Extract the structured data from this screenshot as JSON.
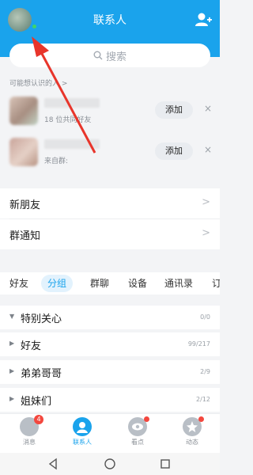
{
  "header": {
    "title": "联系人"
  },
  "search": {
    "placeholder": "搜索"
  },
  "suggestions": {
    "title": "可能想认识的人 >",
    "items": [
      {
        "subtitle": "18 位共同好友",
        "add_label": "添加",
        "dismiss": "×"
      },
      {
        "subtitle": "来自群:",
        "add_label": "添加",
        "dismiss": "×"
      }
    ]
  },
  "rows": [
    {
      "label": "新朋友",
      "chevron": ">"
    },
    {
      "label": "群通知",
      "chevron": ">"
    }
  ],
  "tabs": [
    "好友",
    "分组",
    "群聊",
    "设备",
    "通讯录",
    "订"
  ],
  "active_tab": "分组",
  "groups": [
    {
      "arrow": "▼",
      "name": "特别关心",
      "count": "0/0"
    },
    {
      "arrow": "▶",
      "name": "好友",
      "count": "99/217"
    },
    {
      "arrow": "▶",
      "name": "弟弟哥哥",
      "count": "2/9"
    },
    {
      "arrow": "▶",
      "name": "姐妹们",
      "count": "2/12"
    }
  ],
  "bottom_nav": [
    {
      "label": "消息",
      "badge": "4",
      "icon": "message-icon"
    },
    {
      "label": "联系人",
      "icon": "contacts-icon",
      "active": true
    },
    {
      "label": "看点",
      "icon": "eye-icon",
      "dot": true
    },
    {
      "label": "动态",
      "icon": "star-icon",
      "dot": true
    }
  ],
  "colors": {
    "brand": "#1aa3ec",
    "badge": "#f3473e",
    "arrow": "#e8352b"
  }
}
